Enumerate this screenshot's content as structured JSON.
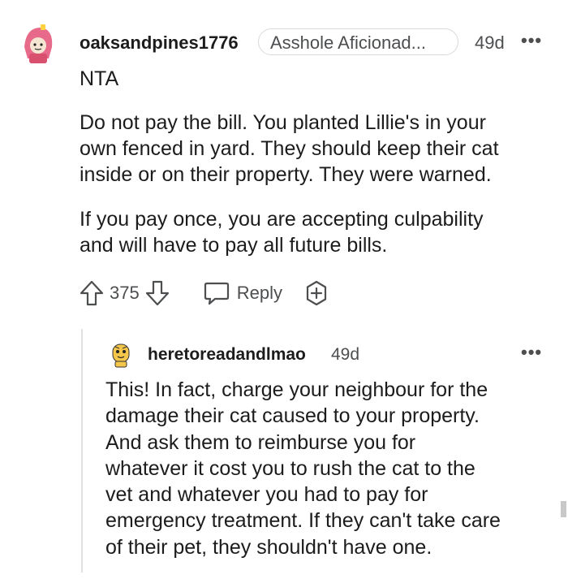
{
  "comment": {
    "username": "oaksandpines1776",
    "flair": "Asshole Aficionad...",
    "time": "49d",
    "more": "•••",
    "verdict": "NTA",
    "para1": [
      "Do not pay the bill. You planted Lillie's in your",
      "own fenced in yard. They should keep their cat",
      "inside or on their property. They were warned."
    ],
    "para2": [
      "If you pay once, you are accepting culpability",
      "and will have to pay all future bills."
    ],
    "upvotes": "375",
    "reply_label": "Reply"
  },
  "reply": {
    "username": "heretoreadandlmao",
    "time": "49d",
    "more": "•••",
    "lines": [
      "This! In fact, charge your neighbour for the",
      "damage their cat caused to your property.",
      "And ask them to reimburse you for",
      "whatever it cost you to rush the cat to the",
      "vet and whatever you had to pay for",
      "emergency treatment. If they can't take care",
      "of their pet, they shouldn't have one."
    ]
  },
  "icons": {
    "upvote": "upvote-arrow-icon",
    "downvote": "downvote-arrow-icon",
    "reply": "speech-bubble-icon",
    "award": "plus-award-icon",
    "more": "ellipsis-icon"
  },
  "colors": {
    "text": "#1c1c1c",
    "meta": "#4c4e50",
    "flair_border": "#d7d9db",
    "thread_line": "#e0e0e0"
  }
}
